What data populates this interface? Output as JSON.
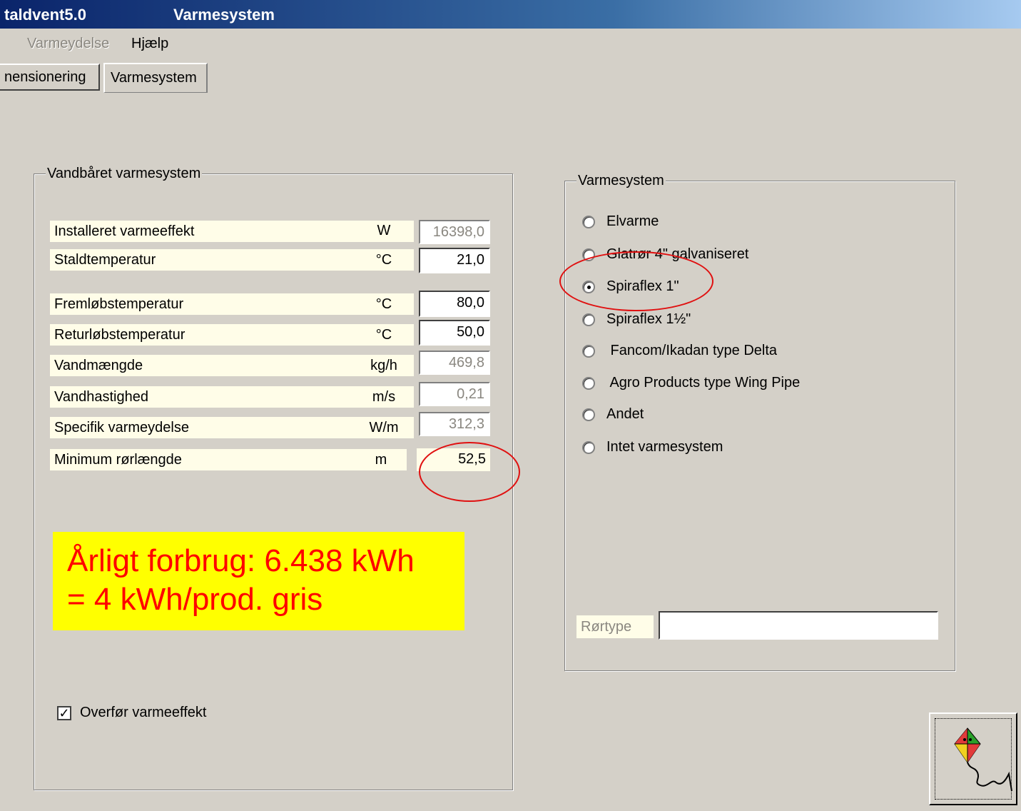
{
  "window": {
    "app_title": "taldvent5.0",
    "title": "Varmesystem"
  },
  "menu": {
    "item1": "Varmeydelse",
    "item2": "Hjælp"
  },
  "tabs": {
    "tab1": "nensionering",
    "tab2": "Varmesystem"
  },
  "left_group": {
    "legend": "Vandbåret varmesystem",
    "rows": [
      {
        "label": "Installeret varmeeffekt",
        "unit": "W",
        "value": "16398,0"
      },
      {
        "label": "Staldtemperatur",
        "unit": "°C",
        "value": "21,0"
      },
      {
        "label": "Fremløbstemperatur",
        "unit": "°C",
        "value": "80,0"
      },
      {
        "label": "Returløbstemperatur",
        "unit": "°C",
        "value": "50,0"
      },
      {
        "label": "Vandmængde",
        "unit": "kg/h",
        "value": "469,8"
      },
      {
        "label": "Vandhastighed",
        "unit": "m/s",
        "value": "0,21"
      },
      {
        "label": "Specifik varmeydelse",
        "unit": "W/m",
        "value": "312,3"
      },
      {
        "label": "Minimum rørlængde",
        "unit": "m",
        "value": "52,5"
      }
    ],
    "callout_line1": "Årligt forbrug: 6.438 kWh",
    "callout_line2": "= 4 kWh/prod. gris",
    "checkbox_label": "Overfør varmeeffekt",
    "checkbox_checked": true
  },
  "right_group": {
    "legend": "Varmesystem",
    "options": [
      "Elvarme",
      "Glatrør 4\" galvaniseret",
      "Spiraflex 1\"",
      "Spiraflex 1½\"",
      " Fancom/Ikadan type Delta",
      " Agro Products type Wing Pipe",
      "Andet",
      "Intet varmesystem"
    ],
    "selected": "Spiraflex 1\"",
    "roertype_label": "Rørtype",
    "roertype_value": ""
  },
  "colors": {
    "highlight_ellipse": "#e01010",
    "callout_bg": "#ffff00",
    "callout_text": "#ff0000"
  },
  "help_button_icon": "kite-icon"
}
